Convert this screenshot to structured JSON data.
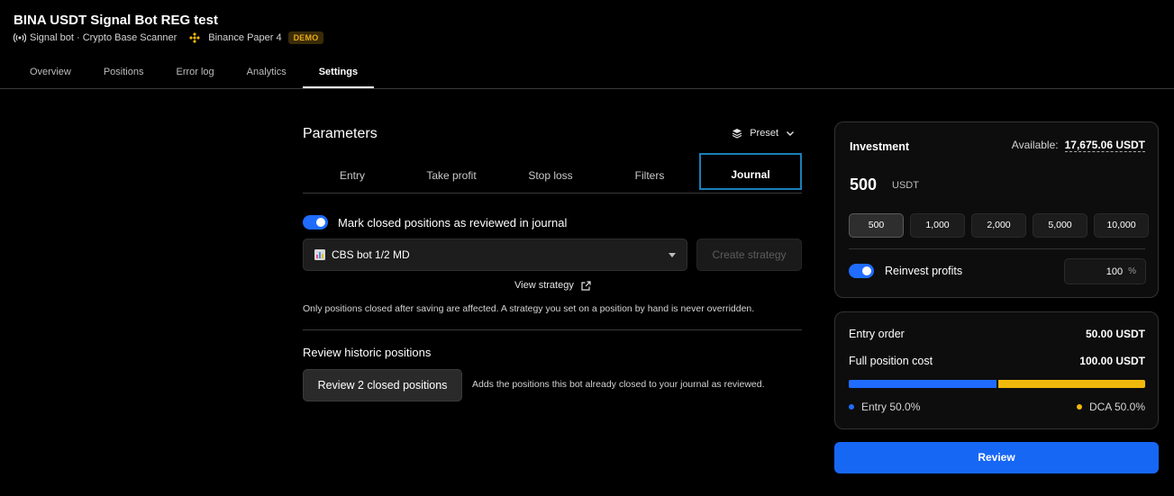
{
  "header": {
    "title": "BINA USDT Signal Bot REG test",
    "bot_type": "Signal bot · Crypto Base Scanner",
    "account": "Binance Paper 4",
    "badge": "DEMO"
  },
  "main_tabs": [
    {
      "label": "Overview",
      "active": false
    },
    {
      "label": "Positions",
      "active": false
    },
    {
      "label": "Error log",
      "active": false
    },
    {
      "label": "Analytics",
      "active": false
    },
    {
      "label": "Settings",
      "active": true
    }
  ],
  "parameters": {
    "title": "Parameters",
    "preset_label": "Preset",
    "tabs": [
      {
        "label": "Entry",
        "active": false
      },
      {
        "label": "Take profit",
        "active": false
      },
      {
        "label": "Stop loss",
        "active": false
      },
      {
        "label": "Filters",
        "active": false
      },
      {
        "label": "Journal",
        "active": true
      }
    ],
    "journal": {
      "mark_label": "Mark closed positions as reviewed in journal",
      "mark_enabled": true,
      "strategy_value": "CBS bot 1/2 MD",
      "create_strategy_label": "Create strategy",
      "view_strategy_label": "View strategy",
      "note": "Only positions closed after saving are affected. A strategy you set on a position by hand is never overridden.",
      "historic_title": "Review historic positions",
      "review_closed_label": "Review 2 closed positions",
      "historic_note": "Adds the positions this bot already closed to your journal as reviewed."
    }
  },
  "investment": {
    "title": "Investment",
    "available_label": "Available:",
    "available_amount": "17,675.06 USDT",
    "value": "500",
    "unit": "USDT",
    "amounts": [
      "500",
      "1,000",
      "2,000",
      "5,000",
      "10,000"
    ],
    "selected_amount": "500",
    "reinvest_label": "Reinvest profits",
    "reinvest_enabled": true,
    "reinvest_percent": "100",
    "reinvest_unit": "%"
  },
  "cost": {
    "entry_order_label": "Entry order",
    "entry_order_value": "50.00 USDT",
    "full_cost_label": "Full position cost",
    "full_cost_value": "100.00 USDT",
    "entry_fraction": 0.5,
    "dca_fraction": 0.5,
    "entry_legend": "Entry 50.0%",
    "dca_legend": "DCA 50.0%"
  },
  "colors": {
    "accent_blue": "#1f6cff",
    "dca_yellow": "#f0b90b",
    "active_tab_border": "#1b7fb8"
  },
  "review_button": "Review"
}
